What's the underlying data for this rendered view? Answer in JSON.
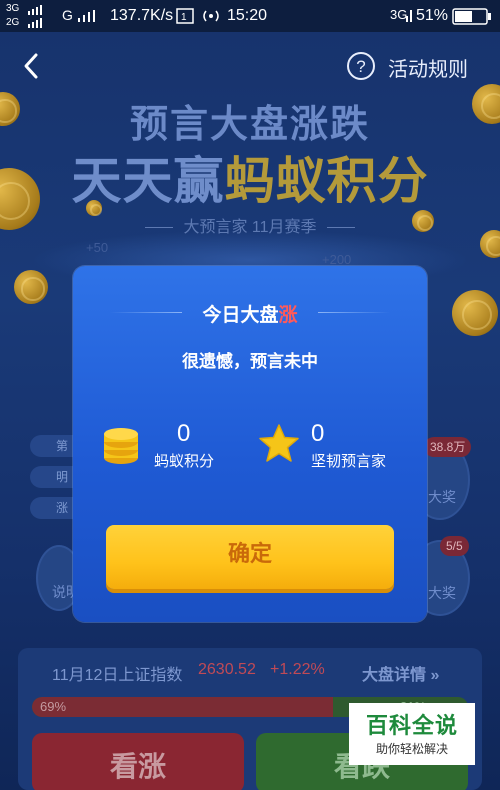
{
  "status_bar": {
    "sim1": "3G",
    "sim2": "2G",
    "network": "G",
    "speed": "137.7K/s",
    "time": "15:20",
    "signal_type": "3G",
    "battery": "51%"
  },
  "nav": {
    "back_icon": "chevron-left-icon",
    "help_icon": "question-circle-icon",
    "rules_label": "活动规则"
  },
  "hero": {
    "line1": "预言大盘涨跌",
    "line2_white": "天天赢",
    "line2_yellow": "蚂蚁积分",
    "subtitle": "大预言家  11月赛季"
  },
  "background": {
    "float_labels": [
      "+50",
      "+200"
    ],
    "pill_labels": [
      "第",
      "明",
      "涨"
    ],
    "right_tag": "38.8万",
    "right_label": "大奖",
    "left_circle_label": "说明",
    "right_circle_tag": "5/5",
    "right_circle_label": "大奖"
  },
  "index_panel": {
    "date_label": "11月12日上证指数",
    "value": "2630.52",
    "change": "+1.22%",
    "detail_label": "大盘详情",
    "detail_arrow": "»",
    "up_percent_label": "69%",
    "down_percent_label": "31%",
    "up_fraction": 0.69,
    "up_button": "看涨",
    "down_button": "看跌"
  },
  "modal": {
    "title_prefix": "今日大盘",
    "title_highlight": "涨",
    "message": "很遗憾，预言未中",
    "stats": [
      {
        "icon": "coin-stack-icon",
        "value": "0",
        "label": "蚂蚁积分"
      },
      {
        "icon": "star-icon",
        "value": "0",
        "label": "坚韧预言家"
      }
    ],
    "confirm_label": "确定"
  },
  "watermark": {
    "main": "百科全说",
    "sub": "助你轻松解决"
  },
  "colors": {
    "modal_blue": "#2f73e8",
    "confirm_yellow": "#ffc21a",
    "highlight_red": "#ff5a5a",
    "coin_gold": "#f5c518"
  }
}
